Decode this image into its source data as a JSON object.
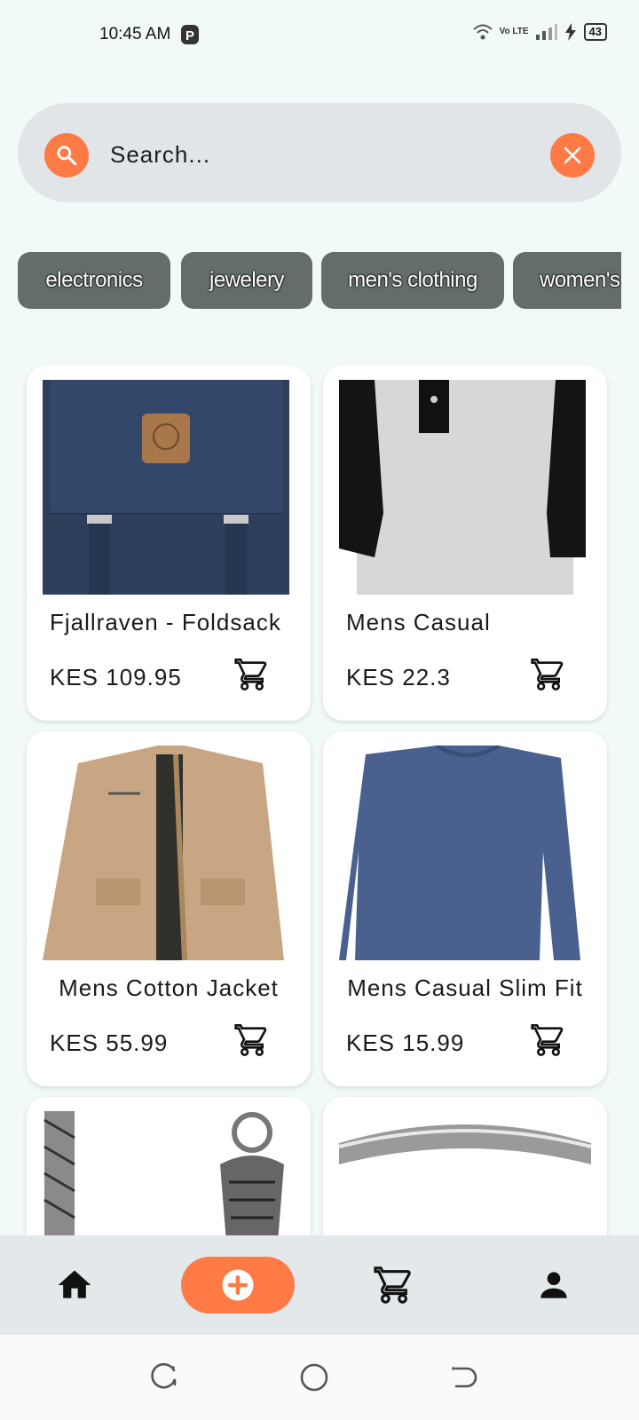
{
  "status_bar": {
    "time": "10:45 AM",
    "battery": "43",
    "network": "Vo LTE",
    "icons": [
      "parking-icon",
      "wifi-icon",
      "signal-icon",
      "charging-icon",
      "battery-icon"
    ]
  },
  "search": {
    "placeholder": "Search...",
    "value": "",
    "accent_color": "#ff7a45"
  },
  "categories": [
    {
      "label": "electronics"
    },
    {
      "label": "jewelery"
    },
    {
      "label": "men's clothing"
    },
    {
      "label": "women's clothing"
    }
  ],
  "products": [
    {
      "title": "Fjallraven - Foldsack",
      "price": "KES 109.95",
      "image": "navy-backpack"
    },
    {
      "title": "Mens Casual",
      "price": "KES 22.3",
      "image": "raglan-shirt"
    },
    {
      "title": "Mens Cotton Jacket",
      "price": "KES 55.99",
      "image": "khaki-jacket"
    },
    {
      "title": "Mens Casual Slim Fit",
      "price": "KES 15.99",
      "image": "blue-longsleeve"
    },
    {
      "title": "",
      "price": "",
      "image": "silver-chain-bracelet"
    },
    {
      "title": "",
      "price": "",
      "image": "silver-ring"
    }
  ],
  "bottom_nav": {
    "items": [
      "home-icon",
      "add-icon",
      "cart-icon",
      "profile-icon"
    ],
    "accent_color": "#ff7a45"
  },
  "colors": {
    "background": "#f2f9f9",
    "chip": "#646c6c",
    "accent": "#ff7a45"
  }
}
